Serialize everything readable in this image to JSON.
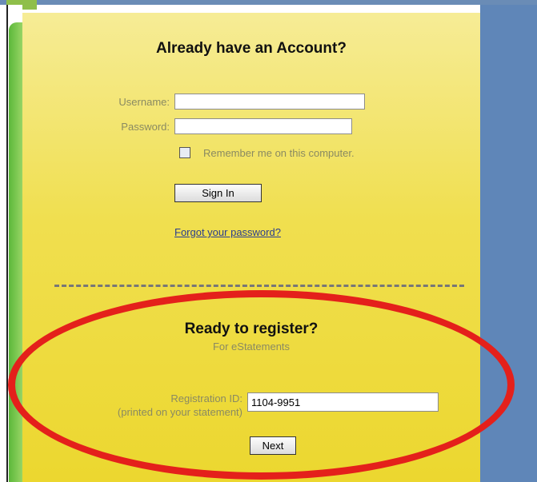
{
  "login": {
    "heading": "Already have an Account?",
    "username_label": "Username:",
    "username_value": "",
    "password_label": "Password:",
    "password_value": "",
    "remember_label": "Remember me on this computer.",
    "remember_checked": false,
    "signin_label": "Sign In",
    "forgot_link": "Forgot your password?"
  },
  "register": {
    "heading": "Ready to register?",
    "subheading": "For eStatements",
    "regid_label": "Registration ID:",
    "regid_note": "(printed on your statement)",
    "regid_value": "1104-9951",
    "next_label": "Next"
  },
  "colors": {
    "panel_yellow": "#f0df4f",
    "side_blue": "#5f86b8",
    "highlight_red": "#e4201b",
    "accent_green": "#5cb83a"
  }
}
